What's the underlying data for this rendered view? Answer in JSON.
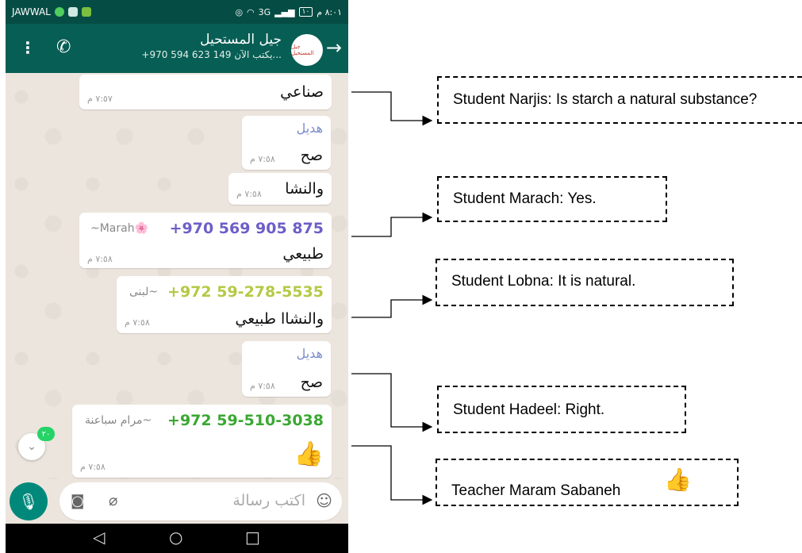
{
  "status_bar": {
    "carrier": "JAWWAL",
    "network": "3G",
    "battery": "١٠",
    "time": "٨:٠١ م"
  },
  "header": {
    "title": "جيل المستحيل",
    "subtitle": "+970 594 623 149 يكتب الآن...",
    "avatar_text": "جيل المستحيل"
  },
  "messages": [
    {
      "sender": "",
      "sender_phone": "",
      "sender_alias": "",
      "text": "صناعي",
      "time": "٧:٥٧ م"
    },
    {
      "sender": "هديل",
      "sender_phone": "",
      "sender_alias": "",
      "text": "صح",
      "time": "٧:٥٨ م"
    },
    {
      "sender": "",
      "sender_phone": "",
      "sender_alias": "",
      "text": "والنشا",
      "time": "٧:٥٨ م"
    },
    {
      "sender": "",
      "sender_phone": "+970 569 905 875",
      "sender_alias": "~Marah🌸",
      "text": "طبيعي",
      "time": "٧:٥٨ م"
    },
    {
      "sender": "",
      "sender_phone": "+972 59-278-5535",
      "sender_alias": "~لبنى",
      "text": "والنشاا طبيعي",
      "time": "٧:٥٨ م"
    },
    {
      "sender": "هديل",
      "sender_phone": "",
      "sender_alias": "",
      "text": "صح",
      "time": "٧:٥٨ م"
    },
    {
      "sender": "",
      "sender_phone": "+972 59-510-3038",
      "sender_alias": "~مرام سباعنة",
      "text": "👍",
      "time": "٧:٥٨ م"
    }
  ],
  "unread_count": "٢٠",
  "input": {
    "placeholder": "اكتب رسالة"
  },
  "annotations": [
    "Student Narjis: Is starch a natural substance?",
    "Student Marach: Yes.",
    "Student Lobna: It is natural.",
    "Student Hadeel: Right.",
    "Teacher Maram Sabaneh"
  ],
  "annotation_emoji": "👍",
  "colors": {
    "header": "#075e54",
    "status_bar": "#054d44",
    "sender_hadeel": "#7b8ccc",
    "sender_marah": "#6c5fc7",
    "sender_lobna": "#b5c944",
    "sender_maram": "#3aa832",
    "mic": "#00897b"
  }
}
